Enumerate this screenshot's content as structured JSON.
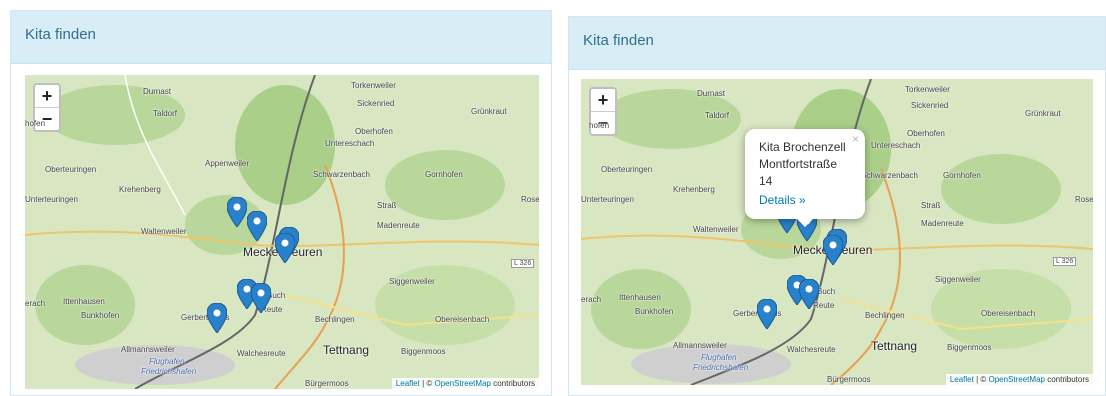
{
  "panel_title": "Kita finden",
  "zoom": {
    "in": "+",
    "out": "−"
  },
  "attribution": {
    "leaflet": "Leaflet",
    "sep": " | © ",
    "osm": "OpenStreetMap",
    "suffix": " contributors"
  },
  "place_labels": {
    "durnast": "Durnast",
    "taldorf": "Taldorf",
    "torkenweiler": "Torkenweiler",
    "sickenried": "Sickenried",
    "gruenkraut": "Grünkraut",
    "oberhofen": "Oberhofen",
    "untereschach": "Untereschach",
    "appenweiler": "Appenweiler",
    "oberteuringen": "Oberteuringen",
    "krehenberg": "Krehenberg",
    "unterteuringen": "Unterteuringen",
    "schwarzenbach": "Schwarzenbach",
    "gornhofen": "Gornhofen",
    "strass": "Straß",
    "madenreute": "Madenreute",
    "waltenweiler": "Waltenweiler",
    "meckenbeuren": "Meckenbeuren",
    "l326": "L 326",
    "siggenweiler": "Siggenweiler",
    "ittenhausen": "Ittenhausen",
    "bunkhofen": "Bunkhofen",
    "gerbertshaus": "Gerbertshaus",
    "reute": "Reute",
    "bechlingen": "Bechlingen",
    "obereisenbach": "Obereisenbach",
    "allmannsweiler": "Allmannsweiler",
    "flughafen": "Flughafen",
    "friedrichshafen": "Friedrichshafen",
    "walchesreute": "Walchesreute",
    "tettnang": "Tettnang",
    "biggenmoos": "Biggenmoos",
    "buergermoos": "Bürgermoos",
    "brochenzell": "Buch",
    "jhofen": "hofen",
    "erach": "erach",
    "rose": "Rose"
  },
  "popup": {
    "name": "Kita Brochenzell",
    "address": "Montfortstraße 14",
    "link": "Details »",
    "close": "×"
  },
  "colors": {
    "panel_heading_bg": "#d9edf7",
    "panel_heading_text": "#31708f",
    "marker": "#2a81cb",
    "link": "#0078a8"
  }
}
